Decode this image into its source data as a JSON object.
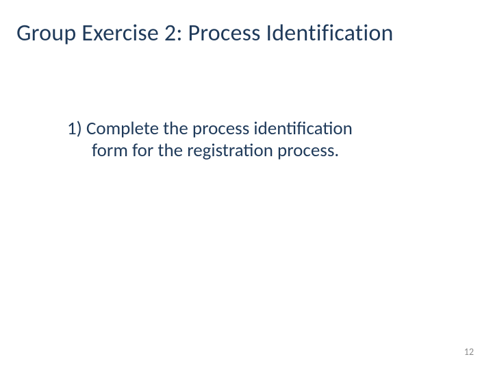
{
  "title": "Group Exercise 2: Process Identification",
  "body": {
    "line1": "1) Complete the process identification",
    "line2": "form for the registration process."
  },
  "page_number": "12"
}
